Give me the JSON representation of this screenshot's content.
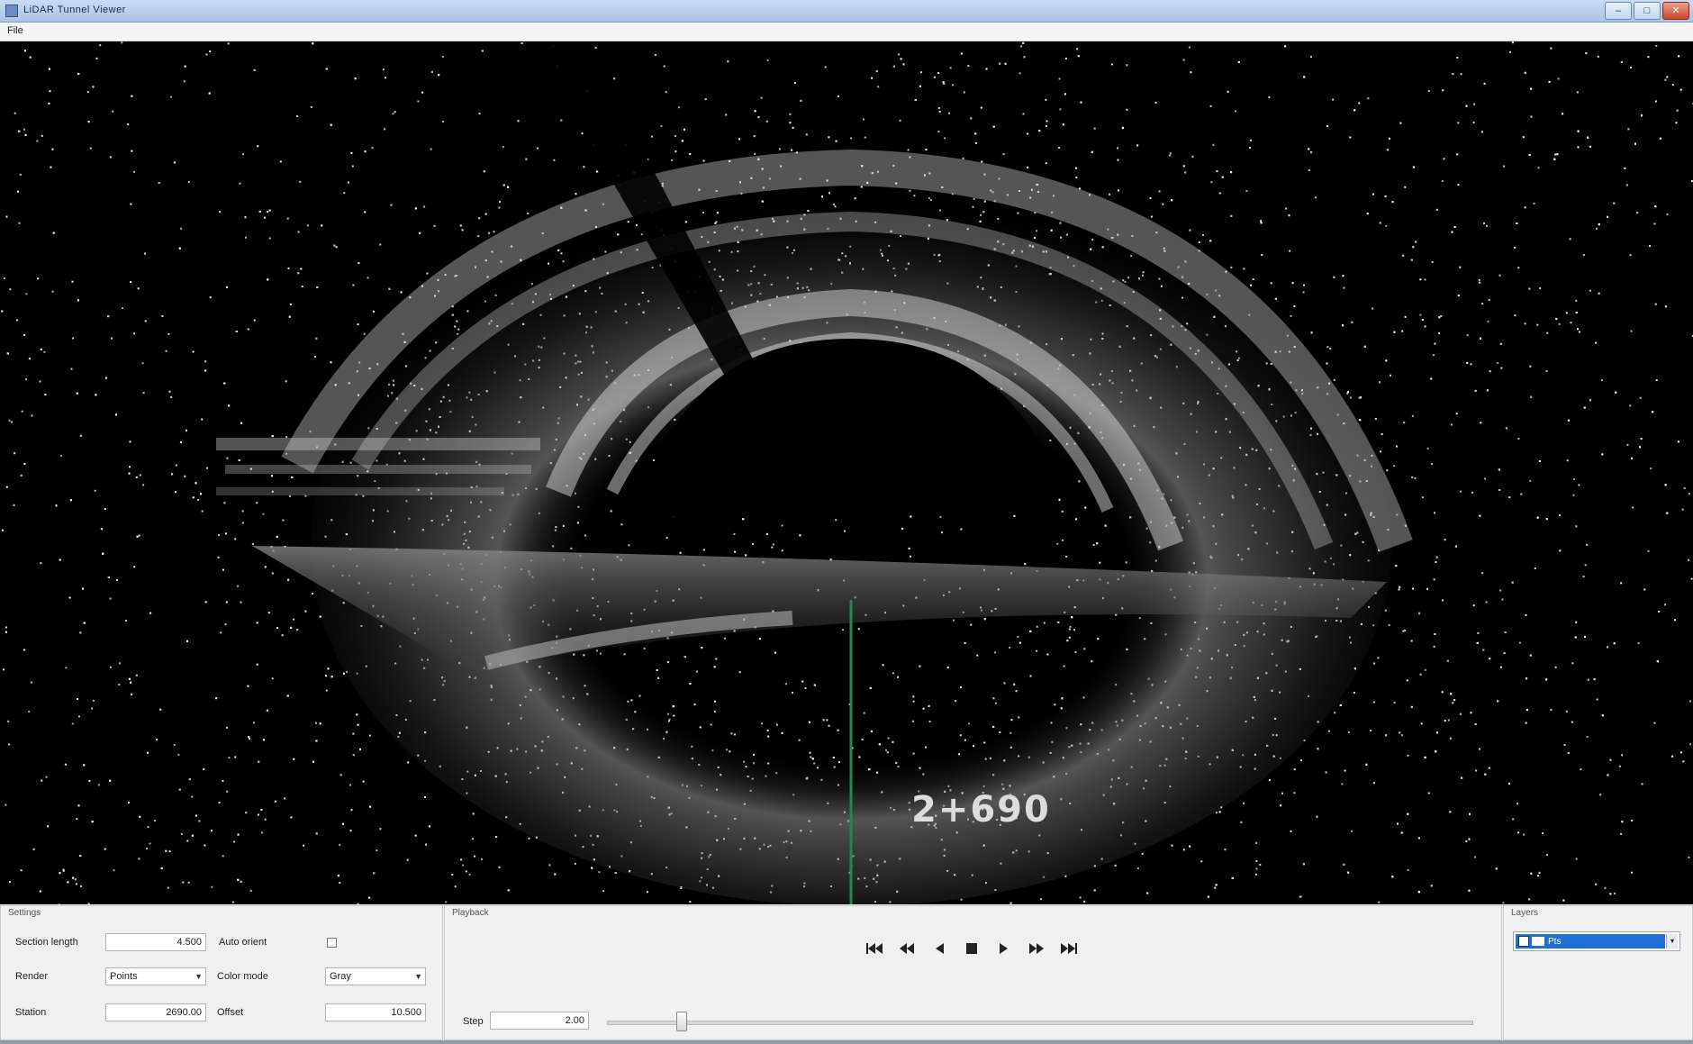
{
  "window": {
    "title": "LiDAR Tunnel Viewer",
    "min_glyph": "–",
    "max_glyph": "□",
    "close_glyph": "✕"
  },
  "menu": {
    "file_label": "File"
  },
  "viewport": {
    "station_label": "2+690",
    "background_color": "#000000",
    "centerline_color": "#1f8a4c"
  },
  "settings_panel": {
    "caption": "Settings",
    "row1": {
      "label": "Section length",
      "value": "4.500",
      "checkbox_label": "Auto orient"
    },
    "row2": {
      "label": "Render",
      "select_value": "Points",
      "label2": "Color mode",
      "select2_value": "Gray"
    },
    "row3": {
      "label": "Station",
      "value": "2690.00",
      "label2": "Offset",
      "value2": "10.500"
    }
  },
  "playback_panel": {
    "caption": "Playback",
    "step_label": "Step",
    "step_value": "2.00",
    "progress": 0.08
  },
  "layers_panel": {
    "caption": "Layers",
    "items": [
      {
        "label": "Pts"
      }
    ]
  },
  "icons": [
    "skip-start-icon",
    "step-back-icon",
    "play-back-icon",
    "stop-icon",
    "play-icon",
    "step-forward-icon",
    "skip-end-icon"
  ]
}
